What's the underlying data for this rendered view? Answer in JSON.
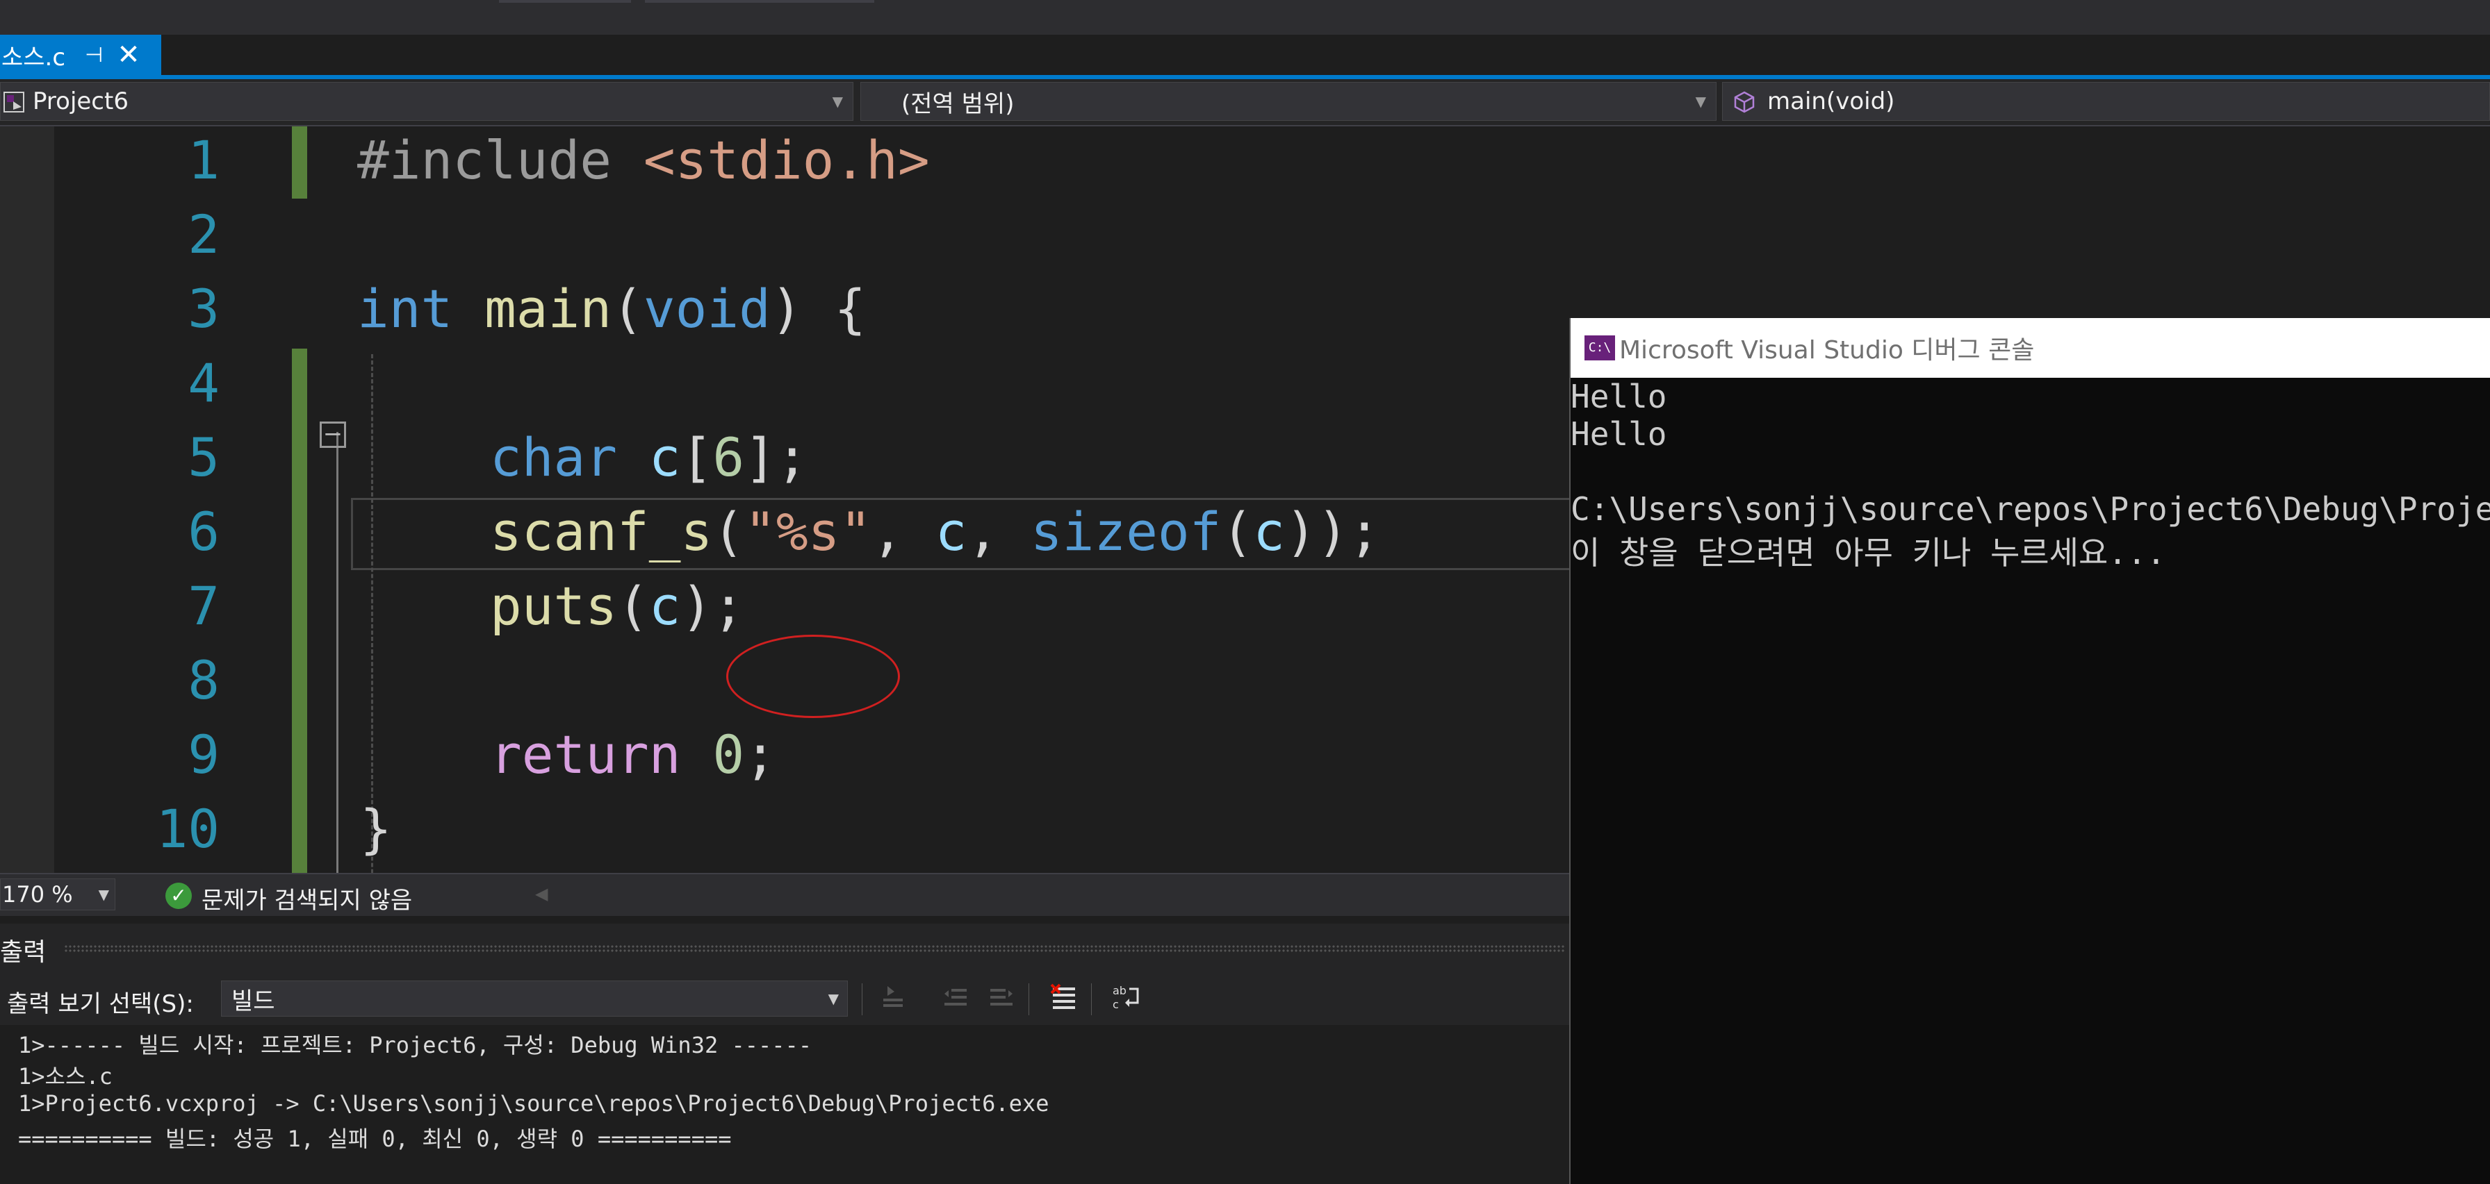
{
  "tab": {
    "label": "소스.c",
    "pin_glyph": "⊣",
    "close_glyph": "✕"
  },
  "nav": {
    "project": "Project6",
    "scope": "(전역 범위)",
    "function": "main(void)"
  },
  "editor": {
    "line_numbers": [
      "1",
      "2",
      "3",
      "4",
      "5",
      "6",
      "7",
      "8",
      "9",
      "10"
    ],
    "fold_glyph": "−",
    "lines": {
      "l1": {
        "pp": "#include ",
        "hdr": "<stdio.h>"
      },
      "l3": {
        "kw1": "int",
        "fn": "main",
        "p1": "(",
        "kw2": "void",
        "p2": ") {"
      },
      "l5": {
        "kw": "char",
        "var": "c",
        "p1": "[",
        "num": "6",
        "p2": "];"
      },
      "l6": {
        "fn": "scanf_s",
        "p1": "(",
        "str": "\"%s\"",
        "p2": ", ",
        "var1": "c",
        "p3": ", ",
        "kw": "sizeof",
        "p4": "(",
        "var2": "c",
        "p5": "));"
      },
      "l7": {
        "fn": "puts",
        "p1": "(",
        "var": "c",
        "p2": ");"
      },
      "l9": {
        "ctl": "return",
        "num": "0",
        "p": ";"
      },
      "l10": {
        "p": "}"
      }
    }
  },
  "status": {
    "zoom": "170 %",
    "issues": "문제가 검색되지 않음",
    "ok_glyph": "✓"
  },
  "output": {
    "title": "출력",
    "select_label": "출력 보기 선택(S):",
    "select_value": "빌드",
    "lines": [
      "1>------ 빌드 시작: 프로젝트: Project6, 구성: Debug Win32 ------",
      "1>소스.c",
      "1>Project6.vcxproj -> C:\\Users\\sonjj\\source\\repos\\Project6\\Debug\\Project6.exe",
      "========== 빌드: 성공 1, 실패 0, 최신 0, 생략 0 =========="
    ],
    "toolbar_icons": [
      "go-to-previous-icon",
      "shift-left-icon",
      "shift-right-icon",
      "clear-all-icon",
      "word-wrap-icon"
    ]
  },
  "console": {
    "title": "Microsoft Visual Studio 디버그 콘솔",
    "icon_label": "C:\\",
    "lines": [
      "Hello",
      "Hello",
      "",
      "C:\\Users\\sonjj\\source\\repos\\Project6\\Debug\\Projec",
      "이 창을 닫으려면 아무 키나 누르세요..."
    ]
  },
  "colors": {
    "accent": "#007acc",
    "keyword": "#569cd6",
    "string": "#d69d85",
    "function": "#dcdcaa",
    "variable": "#9cdcfe",
    "number": "#b5cea8",
    "control": "#d8a0df",
    "line_number": "#2b91af",
    "change_marker": "#57803b",
    "annotation_circle": "#d02020"
  }
}
